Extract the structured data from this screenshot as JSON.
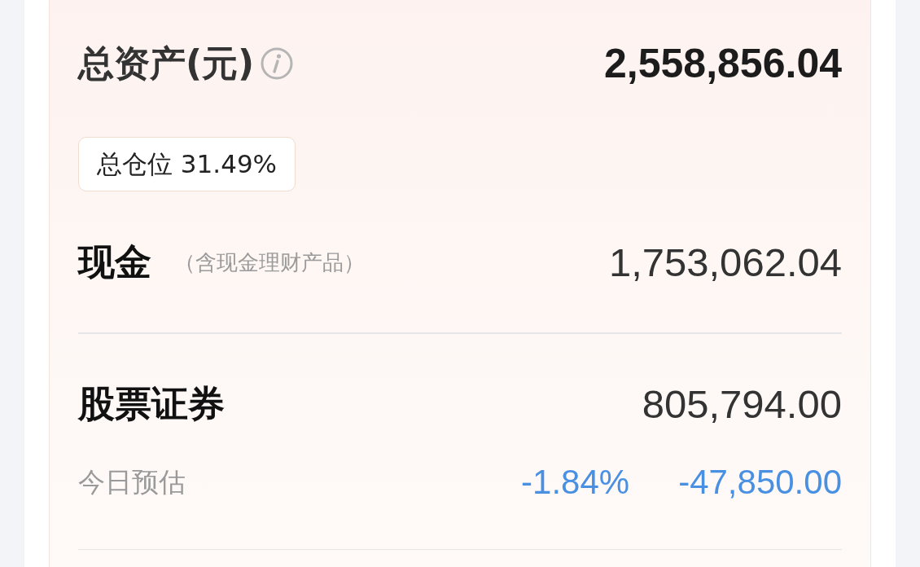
{
  "total_assets": {
    "label": "总资产(元)",
    "value": "2,558,856.04"
  },
  "total_position": "总仓位 31.49%",
  "cash": {
    "label": "现金",
    "note": "（含现金理财产品）",
    "value": "1,753,062.04"
  },
  "securities": {
    "label": "股票证券",
    "value": "805,794.00",
    "today_estimate": {
      "label": "今日预估",
      "falling": true,
      "change_percent": "-1.84%",
      "change_amount": "-47,850.00"
    }
  }
}
